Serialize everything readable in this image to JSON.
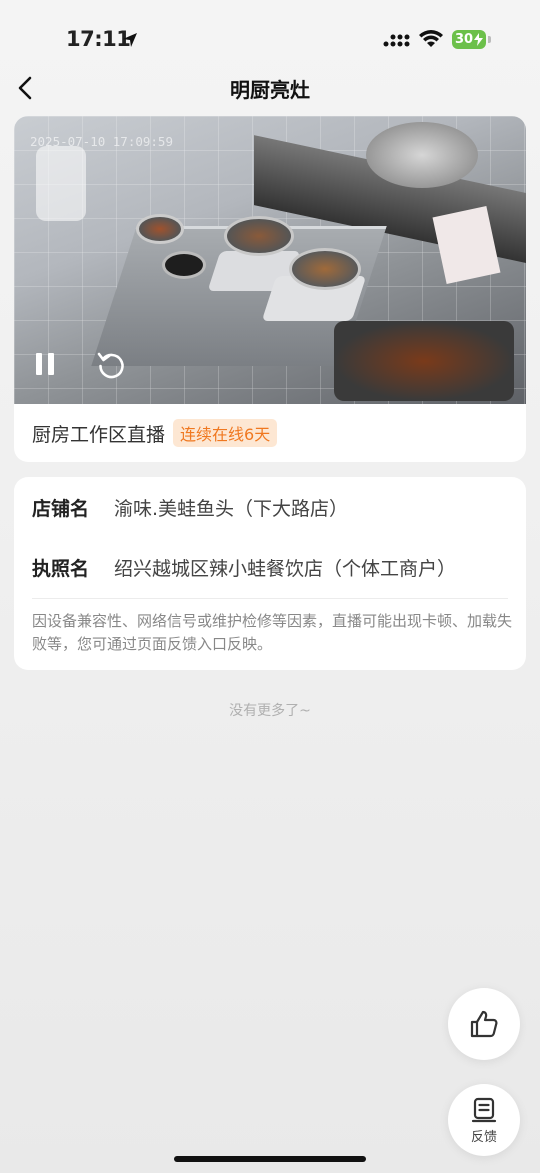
{
  "status_bar": {
    "time": "17:11",
    "battery": "30"
  },
  "nav": {
    "title": "明厨亮灶"
  },
  "video": {
    "timestamp": "2025-07-10 17:09:59",
    "live_label": "厨房工作区直播",
    "live_badge": "连续在线6天"
  },
  "info": {
    "store_key": "店铺名",
    "store_value": "渝味.美蛙鱼头（下大路店）",
    "license_key": "执照名",
    "license_value": "绍兴越城区辣小蛙餐饮店（个体工商户）",
    "notice": "因设备兼容性、网络信号或维护检修等因素，直播可能出现卡顿、加载失败等，您可通过页面反馈入口反映。"
  },
  "footer": {
    "no_more": "没有更多了~"
  },
  "fab": {
    "feedback_label": "反馈"
  },
  "colors": {
    "badge_bg": "#fde7d3",
    "badge_text": "#f07820",
    "battery": "#6cc04a"
  }
}
